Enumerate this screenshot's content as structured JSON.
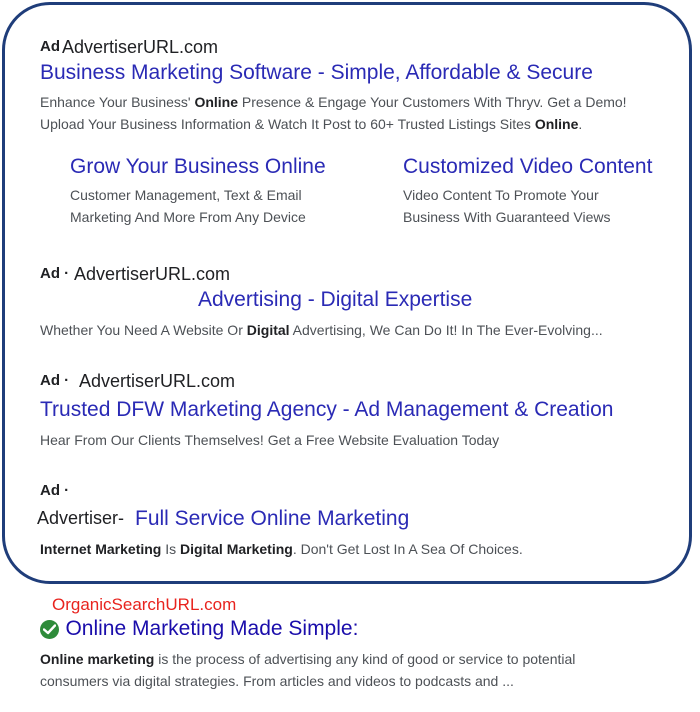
{
  "ads": [
    {
      "label": "Ad",
      "url": "AdvertiserURL.com",
      "title": "Business Marketing Software - Simple, Affordable & Secure",
      "desc_parts": [
        {
          "t": "Enhance Your Business' ",
          "b": false
        },
        {
          "t": "Online",
          "b": true
        },
        {
          "t": " Presence & Engage Your Customers With Thryv. Get a Demo!",
          "b": false
        },
        {
          "t": "\nUpload Your Business Information & Watch It Post to 60+ Trusted Listings Sites ",
          "b": false
        },
        {
          "t": "Online",
          "b": true
        },
        {
          "t": ".",
          "b": false
        }
      ],
      "sitelinks": [
        {
          "title": "Grow Your Business Online",
          "desc1": "Customer Management, Text & Email",
          "desc2": "Marketing And More From Any Device"
        },
        {
          "title": "Customized Video Content",
          "desc1": "Video Content To Promote Your",
          "desc2": "Business With Guaranteed Views"
        }
      ]
    },
    {
      "label": "Ad ·",
      "url": "AdvertiserURL.com",
      "title": "Advertising - Digital Expertise",
      "desc_parts": [
        {
          "t": "Whether You Need A Website Or ",
          "b": false
        },
        {
          "t": "Digital",
          "b": true
        },
        {
          "t": " Advertising, We Can Do It! In The Ever-Evolving...",
          "b": false
        }
      ]
    },
    {
      "label": "Ad ·",
      "url": "AdvertiserURL.com",
      "title": "Trusted DFW Marketing Agency - Ad Management & Creation",
      "desc_parts": [
        {
          "t": "Hear From Our Clients Themselves! Get a Free Website Evaluation Today",
          "b": false
        }
      ]
    },
    {
      "label": "Ad ·",
      "url": "Advertiser-",
      "title": "Full Service Online Marketing",
      "desc_parts": [
        {
          "t": "Internet Marketing",
          "b": true
        },
        {
          "t": " Is ",
          "b": false
        },
        {
          "t": "Digital Marketing",
          "b": true
        },
        {
          "t": ". Don't Get Lost In A Sea Of Choices.",
          "b": false
        }
      ]
    }
  ],
  "organic": {
    "url": "OrganicSearchURL.com",
    "title": "Online Marketing Made Simple:",
    "desc_parts": [
      {
        "t": "Online marketing",
        "b": true
      },
      {
        "t": " is the process of advertising any kind of good or service to potential\nconsumers via digital strategies. From articles and videos to podcasts and ...",
        "b": false
      }
    ]
  },
  "colors": {
    "frame": "#1f3d7a",
    "ad_title": "#2a2ab5",
    "organic_url": "#e8231e",
    "verified": "#2e8b3a"
  },
  "icons": {
    "verified": "check-circle-icon"
  }
}
